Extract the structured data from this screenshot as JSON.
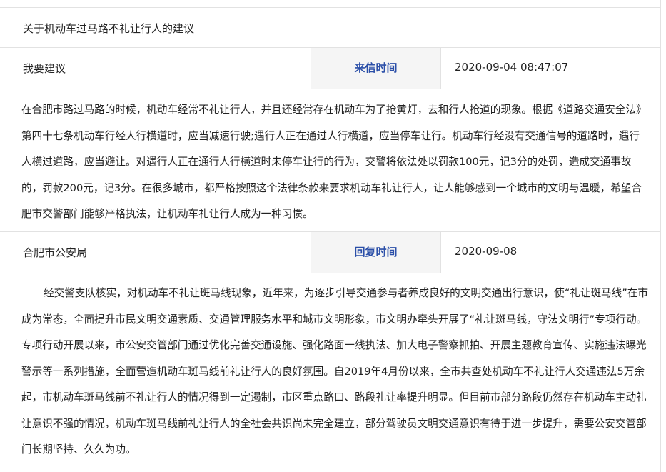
{
  "title": "关于机动车过马路不礼让行人的建议",
  "request": {
    "type": "我要建议",
    "time_label": "来信时间",
    "time_value": "2020-09-04 08:47:07",
    "content": "在合肥市路过马路的时候，机动车经常不礼让行人，并且还经常存在机动车为了抢黄灯，去和行人抢道的现象。根据《道路交通安全法》第四十七条机动车行经人行横道时，应当减速行驶;遇行人正在通过人行横道，应当停车让行。机动车行经没有交通信号的道路时，遇行人横过道路，应当避让。对遇行人正在通行人行横道时未停车让行的行为，交警将依法处以罚款100元，记3分的处罚，造成交通事故的，罚款200元，记3分。在很多城市，都严格按照这个法律条款来要求机动车礼让行人，让人能够感到一个城市的文明与温暖，希望合肥市交警部门能够严格执法，让机动车礼让行人成为一种习惯。"
  },
  "reply": {
    "department": "合肥市公安局",
    "time_label": "回复时间",
    "time_value": "2020-09-08",
    "content": "经交警支队核实，对机动车不礼让斑马线现象，近年来，为逐步引导交通参与者养成良好的文明交通出行意识，使“礼让斑马线”在市成为常态，全面提升市民文明交通素质、交通管理服务水平和城市文明形象，市文明办牵头开展了“礼让斑马线，守法文明行”专项行动。专项行动开展以来，市公安交管部门通过优化完善交通设施、强化路面一线执法、加大电子警察抓拍、开展主题教育宣传、实施违法曝光警示等一系列措施，全面营造机动车斑马线前礼让行人的良好氛围。自2019年4月份以来，全市共查处机动车不礼让行人交通违法5万余起，市机动车斑马线前不礼让行人的情况得到一定遏制，市区重点路口、路段礼让率提升明显。但目前市部分路段仍然存在机动车主动礼让意识不强的情况，机动车斑马线前礼让行人的全社会共识尚未完全建立，部分驾驶员文明交通意识有待于进一步提升，需要公安交管部门长期坚持、久久为功。"
  }
}
